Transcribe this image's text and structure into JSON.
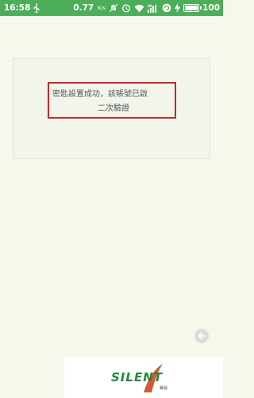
{
  "status_bar": {
    "time": "16:58",
    "net_speed": "0.77",
    "net_unit": "K/s",
    "battery_text": "100",
    "battery_level": 1.0,
    "icons": [
      "usb-icon",
      "mute-icon",
      "alarm-icon",
      "wifi-icon",
      "signal-icon",
      "sync-icon",
      "charging-icon",
      "battery-icon"
    ]
  },
  "message": {
    "line1": "密匙設置成功，該賬號已啟",
    "line2": "二次驗證"
  },
  "watermark": {
    "logo_text": "SILENT",
    "logo_sub": "賽倫"
  },
  "colors": {
    "status_bar": "#4cae5a",
    "background": "#f7f7ec",
    "highlight_border": "#c8262c",
    "logo_green": "#1f8a3a"
  }
}
